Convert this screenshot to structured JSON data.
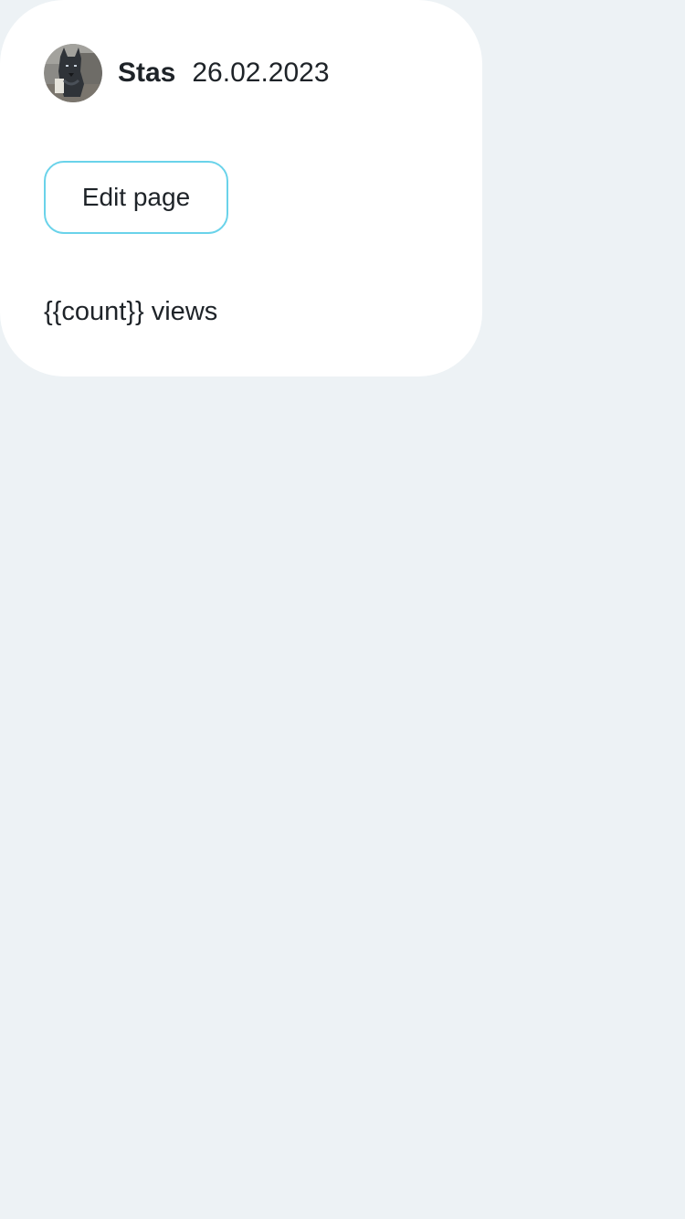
{
  "post": {
    "author_name": "Stas",
    "date": "26.02.2023",
    "views_label": "{{count}} views"
  },
  "actions": {
    "edit_label": "Edit page"
  },
  "icons": {
    "avatar": "user-avatar-photo"
  },
  "colors": {
    "background": "#edf2f5",
    "card": "#ffffff",
    "button_border": "#6ad3ea",
    "text": "#1e2328"
  }
}
